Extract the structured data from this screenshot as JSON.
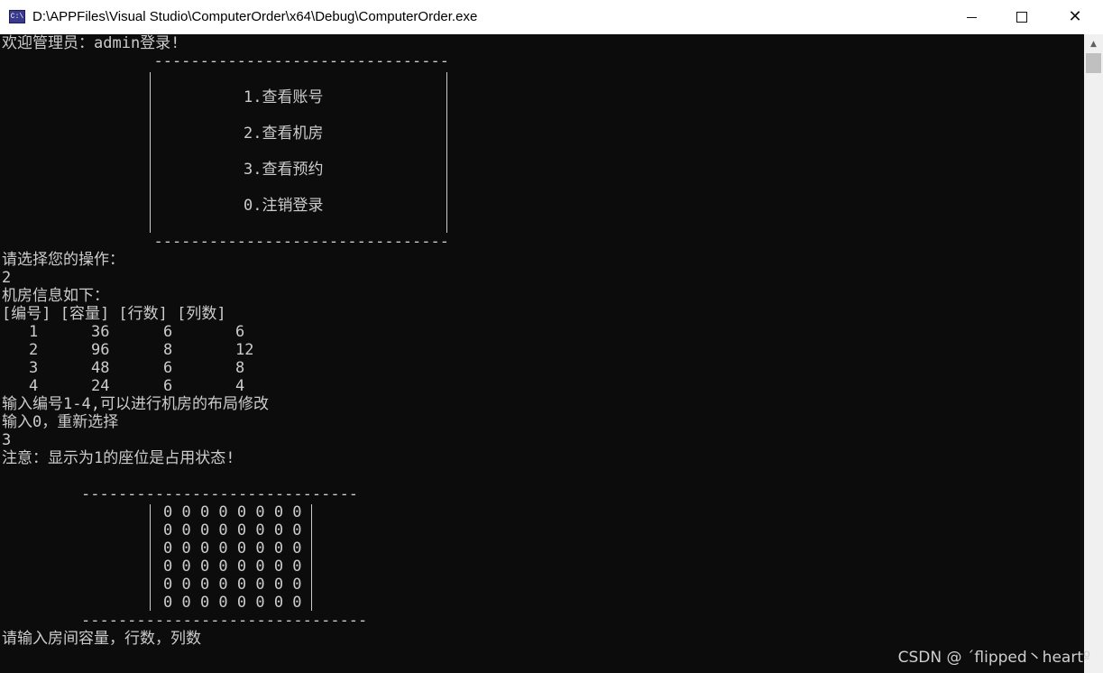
{
  "window": {
    "icon_text": "C:\\",
    "title": "D:\\APPFiles\\Visual Studio\\ComputerOrder\\x64\\Debug\\ComputerOrder.exe",
    "minimize_icon": "minimize-icon",
    "maximize_icon": "maximize-icon",
    "close_icon": "close-icon",
    "close_glyph": "✕"
  },
  "console": {
    "welcome": "欢迎管理员：admin登录!",
    "menu_border_top": "  --------------------------------",
    "menu_items": [
      "1.查看账号",
      "2.查看机房",
      "3.查看预约",
      "0.注销登录"
    ],
    "menu_border_bottom": "  --------------------------------",
    "prompt_choose": "请选择您的操作：",
    "choice_1": "2",
    "room_info_header": "机房信息如下：",
    "table": {
      "headers": "[编号] [容量] [行数] [列数]",
      "rows": [
        [
          "1",
          "36",
          "6",
          "6"
        ],
        [
          "2",
          "96",
          "8",
          "12"
        ],
        [
          "3",
          "48",
          "6",
          "8"
        ],
        [
          "4",
          "24",
          "6",
          "4"
        ]
      ]
    },
    "hint_edit": "输入编号1-4,可以进行机房的布局修改",
    "hint_reselect": "输入0，重新选择",
    "choice_2": "3",
    "notice": "注意：显示为1的座位是占用状态!",
    "seat_border_top": "------------------------------",
    "seat_rows": [
      "0 0 0 0 0 0 0 0",
      "0 0 0 0 0 0 0 0",
      "0 0 0 0 0 0 0 0",
      "0 0 0 0 0 0 0 0",
      "0 0 0 0 0 0 0 0",
      "0 0 0 0 0 0 0 0"
    ],
    "seat_border_bottom": "-------------------------------",
    "prompt_capacity": "请输入房间容量，行数，列数"
  },
  "watermark": "CSDN @ ˊflipped丶heartº",
  "colors": {
    "console_bg": "#0c0c0c",
    "console_text": "#cccccc",
    "titlebar_bg": "#ffffff"
  }
}
